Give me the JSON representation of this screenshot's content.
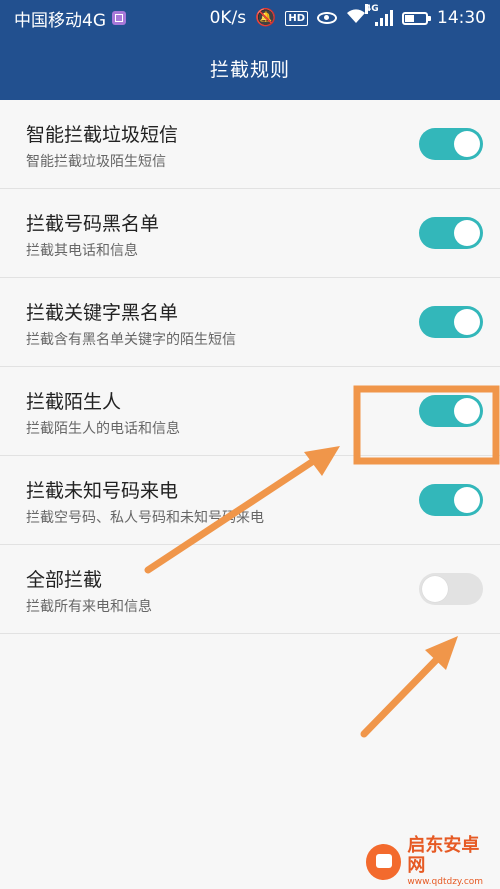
{
  "status_bar": {
    "carrier": "中国移动4G",
    "speed": "0K/s",
    "hd_badge": "HD",
    "network_badge": "4G",
    "time": "14:30"
  },
  "header": {
    "title": "拦截规则"
  },
  "settings": {
    "items": [
      {
        "title": "智能拦截垃圾短信",
        "subtitle": "智能拦截垃圾陌生短信",
        "enabled": true
      },
      {
        "title": "拦截号码黑名单",
        "subtitle": "拦截其电话和信息",
        "enabled": true
      },
      {
        "title": "拦截关键字黑名单",
        "subtitle": "拦截含有黑名单关键字的陌生短信",
        "enabled": true
      },
      {
        "title": "拦截陌生人",
        "subtitle": "拦截陌生人的电话和信息",
        "enabled": true
      },
      {
        "title": "拦截未知号码来电",
        "subtitle": "拦截空号码、私人号码和未知号码来电",
        "enabled": true
      },
      {
        "title": "全部拦截",
        "subtitle": "拦截所有来电和信息",
        "enabled": false
      }
    ]
  },
  "colors": {
    "header_bg": "#22508f",
    "toggle_on": "#33b7ba",
    "toggle_off": "#e2e2e2",
    "annotation": "#f0964a"
  },
  "watermark": {
    "name": "启东安卓网",
    "url": "www.qdtdzy.com"
  }
}
